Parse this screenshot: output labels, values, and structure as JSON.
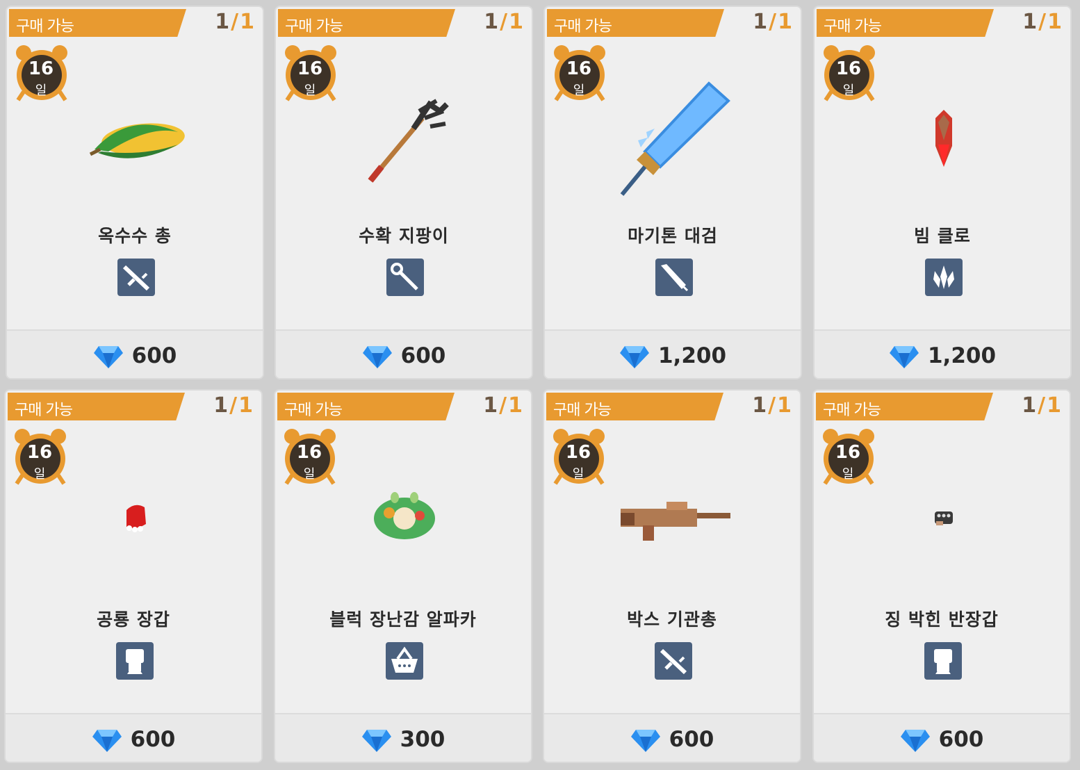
{
  "colors": {
    "banner": "#e89a30",
    "clock": "#3d3227",
    "category_bg": "#4a607e",
    "gem": "#2a8ff0"
  },
  "cards": [
    {
      "status": "구매 가능",
      "stock_current": "1",
      "stock_sep": "/",
      "stock_max": "1",
      "days": "16",
      "days_unit": "일",
      "name": "옥수수 총",
      "category_icon": "rifle-icon",
      "art": "corn-gun",
      "price": "600"
    },
    {
      "status": "구매 가능",
      "stock_current": "1",
      "stock_sep": "/",
      "stock_max": "1",
      "days": "16",
      "days_unit": "일",
      "name": "수확 지팡이",
      "category_icon": "staff-icon",
      "art": "rake-staff",
      "price": "600"
    },
    {
      "status": "구매 가능",
      "stock_current": "1",
      "stock_sep": "/",
      "stock_max": "1",
      "days": "16",
      "days_unit": "일",
      "name": "마기톤 대검",
      "category_icon": "sword-icon",
      "art": "greatsword",
      "price": "1,200"
    },
    {
      "status": "구매 가능",
      "stock_current": "1",
      "stock_sep": "/",
      "stock_max": "1",
      "days": "16",
      "days_unit": "일",
      "name": "빔 클로",
      "category_icon": "claw-icon",
      "art": "beam-claw",
      "price": "1,200"
    },
    {
      "status": "구매 가능",
      "stock_current": "1",
      "stock_sep": "/",
      "stock_max": "1",
      "days": "16",
      "days_unit": "일",
      "name": "공룡 장갑",
      "category_icon": "fist-icon",
      "art": "dino-glove",
      "price": "600"
    },
    {
      "status": "구매 가능",
      "stock_current": "1",
      "stock_sep": "/",
      "stock_max": "1",
      "days": "16",
      "days_unit": "일",
      "name": "블럭 장난감 알파카",
      "category_icon": "basket-icon",
      "art": "alpaca-toy",
      "price": "300"
    },
    {
      "status": "구매 가능",
      "stock_current": "1",
      "stock_sep": "/",
      "stock_max": "1",
      "days": "16",
      "days_unit": "일",
      "name": "박스 기관총",
      "category_icon": "rifle-icon",
      "art": "box-machinegun",
      "price": "600"
    },
    {
      "status": "구매 가능",
      "stock_current": "1",
      "stock_sep": "/",
      "stock_max": "1",
      "days": "16",
      "days_unit": "일",
      "name": "징 박힌 반장갑",
      "category_icon": "fist-icon",
      "art": "studded-glove",
      "price": "600"
    }
  ]
}
